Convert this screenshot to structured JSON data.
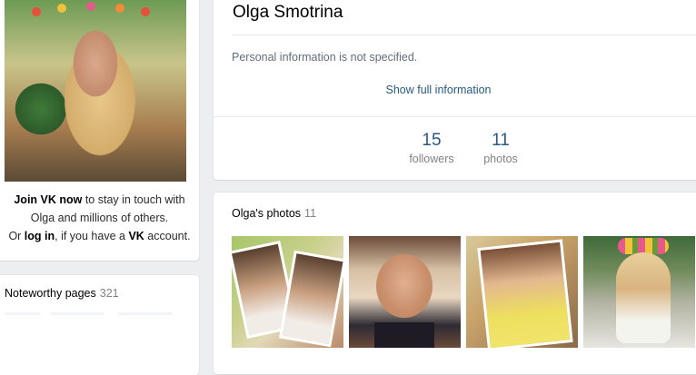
{
  "sidebar": {
    "join_bold": "Join VK now",
    "join_rest": " to stay in touch with",
    "join_line2": "Olga and millions of others.",
    "or": "Or ",
    "login": "log in",
    "if_you_have": ", if you have a ",
    "vk": "VK",
    "account": " account.",
    "noteworthy_label": "Noteworthy pages",
    "noteworthy_count": "321"
  },
  "profile": {
    "name": "Olga Smotrina",
    "personal_info": "Personal information is not specified.",
    "show_full": "Show full information",
    "stats": [
      {
        "value": "15",
        "label": "followers"
      },
      {
        "value": "11",
        "label": "photos"
      }
    ]
  },
  "photos": {
    "label": "Olga's photos",
    "count": "11"
  },
  "colors": {
    "link": "#2a5885",
    "muted": "#828282",
    "page_bg": "#edeef0"
  }
}
